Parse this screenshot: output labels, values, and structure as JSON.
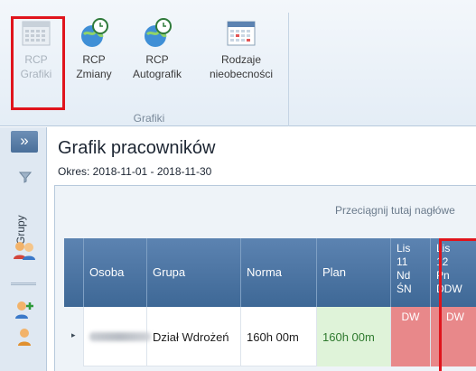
{
  "ribbon": {
    "buttons": [
      {
        "line1": "RCP",
        "line2": "Grafiki",
        "icon": "calendar-grid-icon",
        "disabled": true
      },
      {
        "line1": "RCP",
        "line2": "Zmiany",
        "icon": "globe-clock-icon"
      },
      {
        "line1": "RCP",
        "line2": "Autografik",
        "icon": "globe-clock-icon"
      },
      {
        "line1": "Rodzaje",
        "line2": "nieobecności",
        "icon": "calendar-icon"
      }
    ],
    "group_caption": "Grafiki"
  },
  "rail": {
    "toggle": "»",
    "label": "Grupy",
    "icons": [
      "users-icon",
      "user-add-icon",
      "user-icon"
    ]
  },
  "page": {
    "title": "Grafik pracowników",
    "subtitle": "Okres: 2018-11-01 - 2018-11-30"
  },
  "grid": {
    "drop_hint": "Przeciągnij tutaj nagłówe",
    "columns": [
      "Osoba",
      "Grupa",
      "Norma",
      "Plan"
    ],
    "days": [
      {
        "month": "Lis",
        "day": "11",
        "weekday": "Nd",
        "type": "ŚN"
      },
      {
        "month": "Lis",
        "day": "12",
        "weekday": "Pn",
        "type": "DDW"
      }
    ],
    "rows": [
      {
        "osoba": "",
        "grupa": "Dział Wdrożeń",
        "norma": "160h 00m",
        "plan": "160h 00m",
        "days": [
          "DW",
          "DW"
        ]
      }
    ]
  },
  "colors": {
    "header_blue": "#4a72a2",
    "plan_green": "#dff3d9",
    "day_red": "#e8888a",
    "highlight_red": "#e0141c"
  }
}
